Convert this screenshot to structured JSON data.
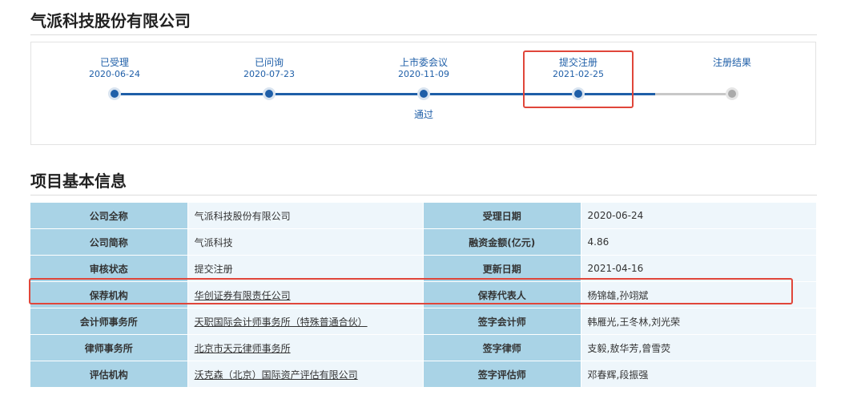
{
  "company_title": "气派科技股份有限公司",
  "timeline": {
    "steps": [
      {
        "label": "已受理",
        "date": "2020-06-24"
      },
      {
        "label": "已问询",
        "date": "2020-07-23"
      },
      {
        "label": "上市委会议",
        "date": "2020-11-09",
        "result": "通过"
      },
      {
        "label": "提交注册",
        "date": "2021-02-25"
      },
      {
        "label": "注册结果",
        "date": ""
      }
    ]
  },
  "section_title": "项目基本信息",
  "info": {
    "rows": [
      {
        "k1": "公司全称",
        "v1": "气派科技股份有限公司",
        "k2": "受理日期",
        "v2": "2020-06-24"
      },
      {
        "k1": "公司简称",
        "v1": "气派科技",
        "k2": "融资金额(亿元)",
        "v2": "4.86"
      },
      {
        "k1": "审核状态",
        "v1": "提交注册",
        "k2": "更新日期",
        "v2": "2021-04-16"
      },
      {
        "k1": "保荐机构",
        "v1": "华创证券有限责任公司",
        "k2": "保荐代表人",
        "v2": "杨锦雄,孙翊斌"
      },
      {
        "k1": "会计师事务所",
        "v1": "天职国际会计师事务所（特殊普通合伙）",
        "k2": "签字会计师",
        "v2": "韩雁光,王冬林,刘光荣"
      },
      {
        "k1": "律师事务所",
        "v1": "北京市天元律师事务所",
        "k2": "签字律师",
        "v2": "支毅,敖华芳,曾雪荧"
      },
      {
        "k1": "评估机构",
        "v1": "沃克森（北京）国际资产评估有限公司",
        "k2": "签字评估师",
        "v2": "邓春辉,段振强"
      }
    ]
  },
  "colors": {
    "accent": "#1f5fa8",
    "highlight": "#e0463a",
    "key_cell": "#a9d3e6",
    "value_cell": "#eef6fb"
  }
}
